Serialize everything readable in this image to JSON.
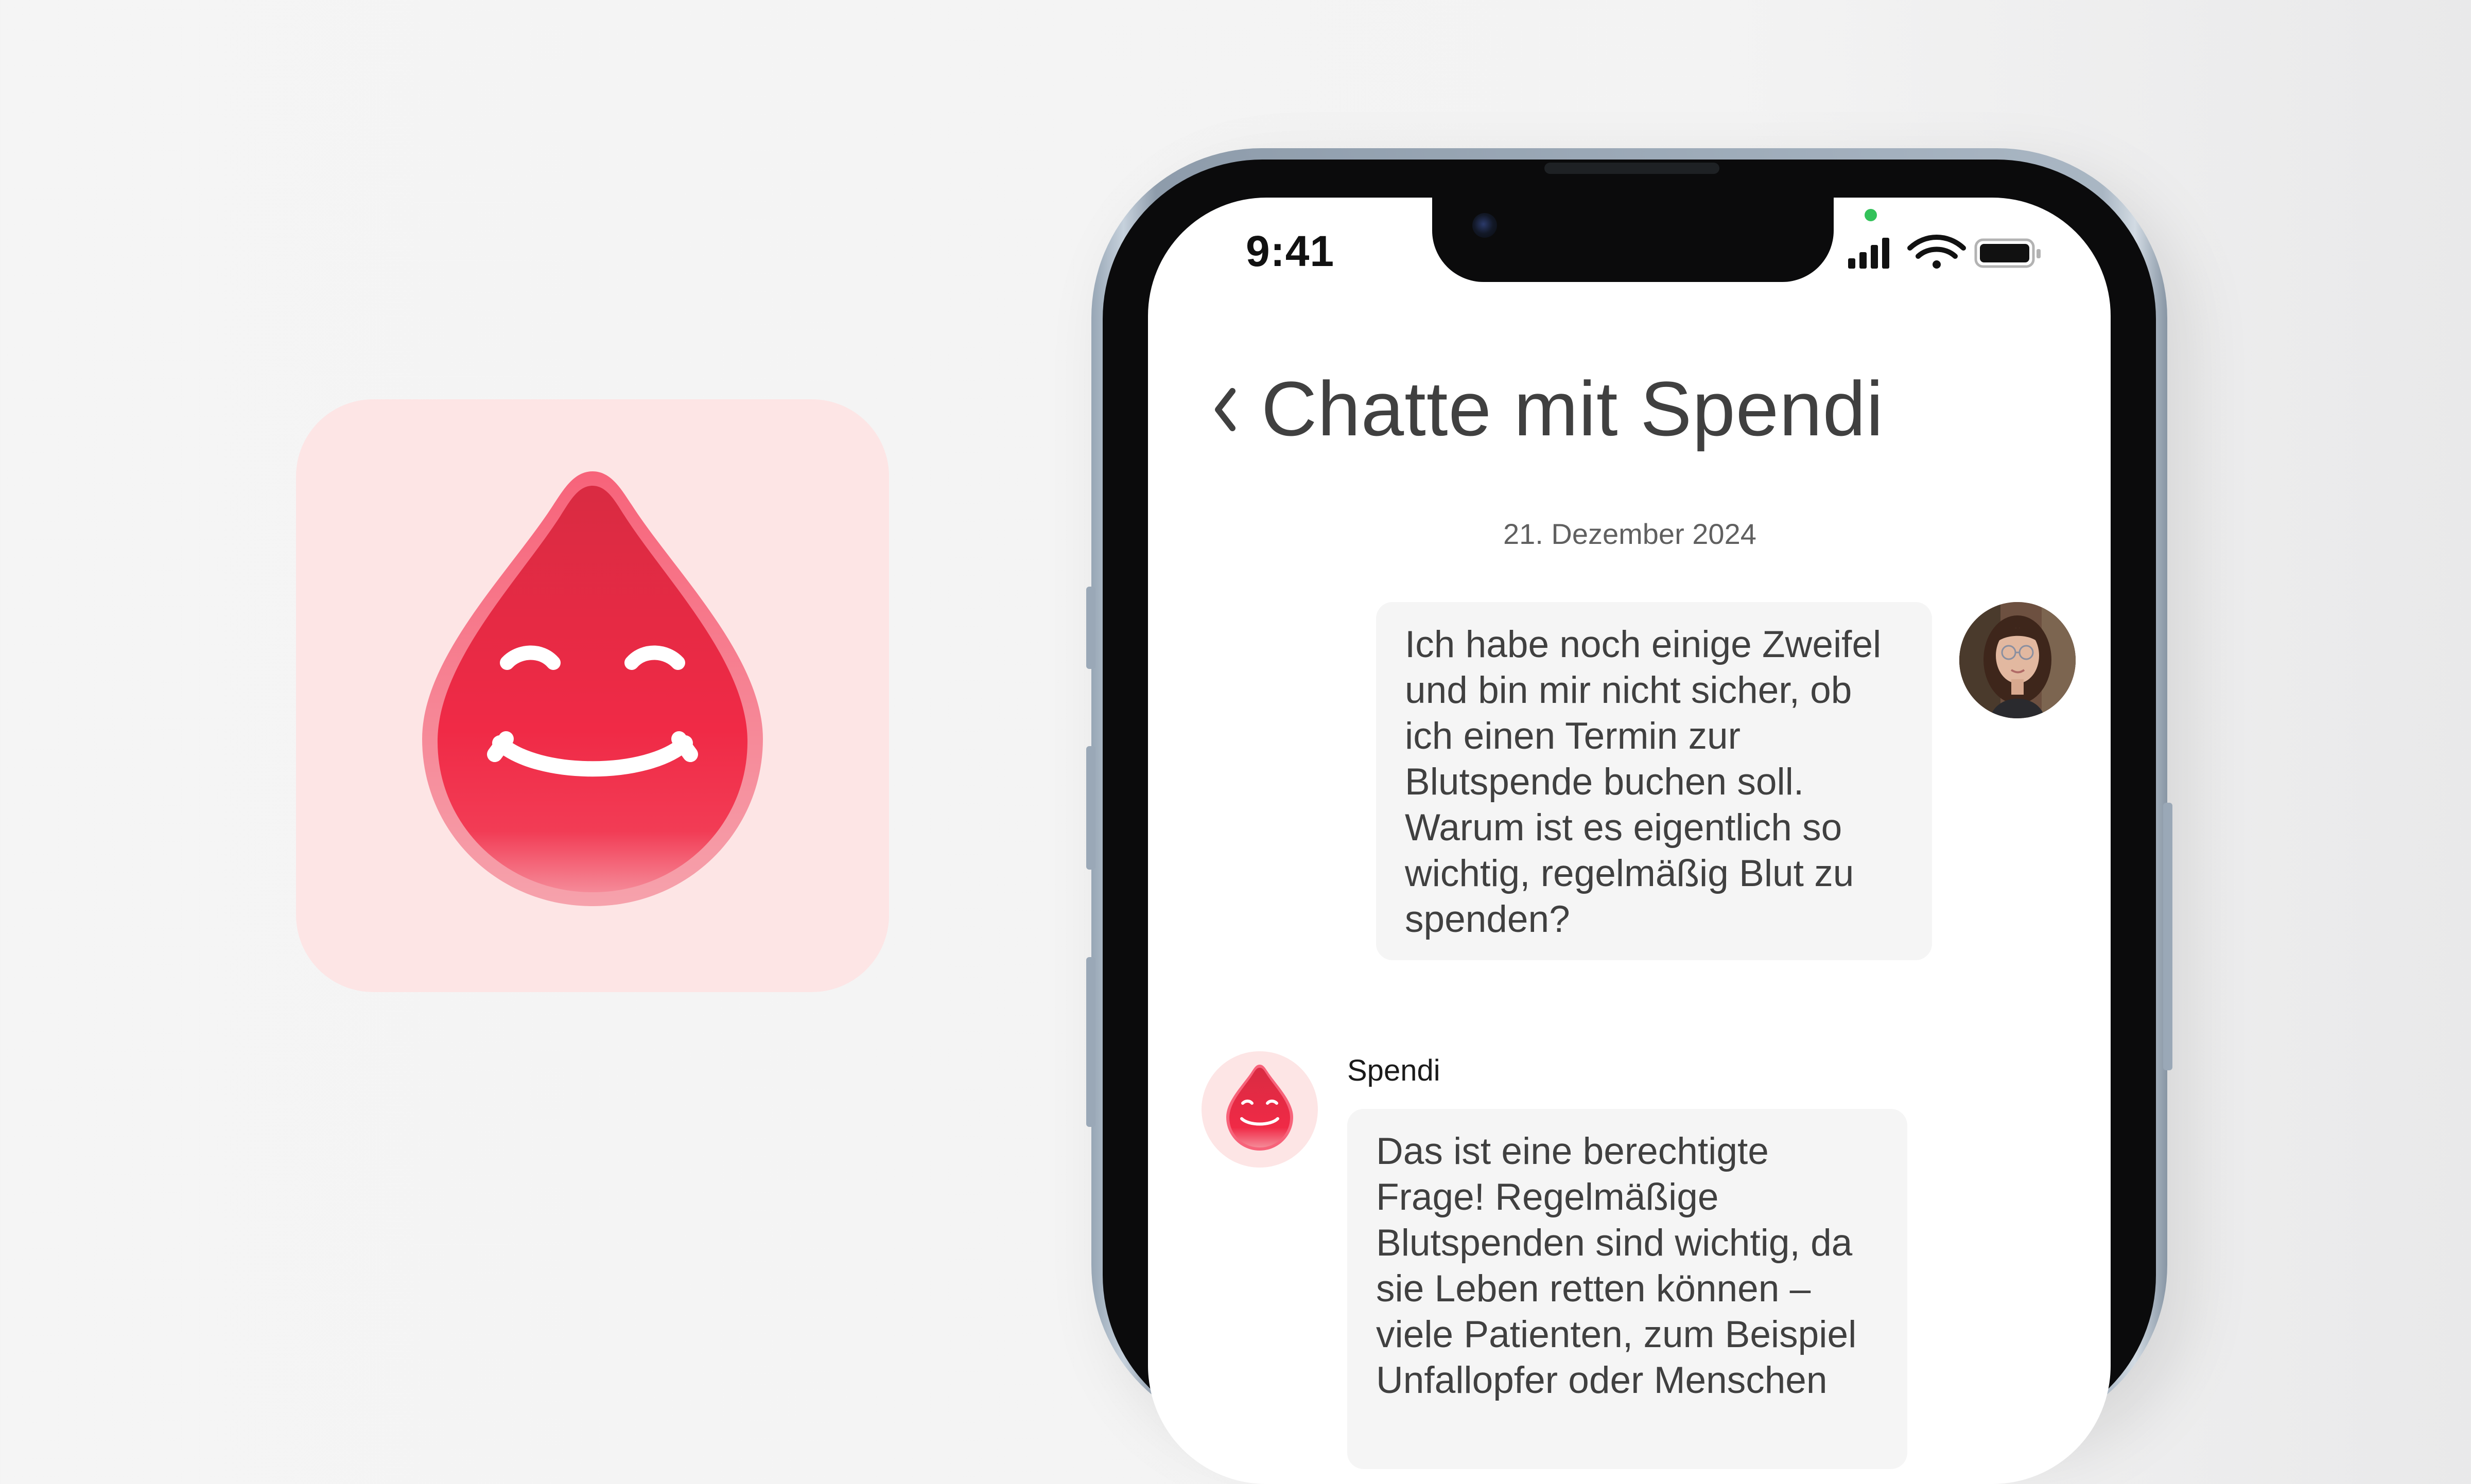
{
  "status_bar": {
    "time": "9:41"
  },
  "header": {
    "title": "Chatte mit Spendi"
  },
  "chat": {
    "date": "21. Dezember 2024",
    "messages": [
      {
        "sender": "user",
        "lines": [
          "Ich habe noch einige Zweifel",
          "und bin mir nicht sicher, ob",
          "ich einen Termin zur",
          "Blutspende buchen soll.",
          "Warum ist es eigentlich so",
          "wichtig, regelmäßig Blut zu",
          "spenden?"
        ]
      },
      {
        "sender": "Spendi",
        "lines": [
          "Das ist eine berechtigte",
          "Frage! Regelmäßige",
          "Blutspenden sind wichtig, da",
          "sie Leben retten können –",
          "viele Patienten, zum Beispiel",
          "Unfallopfer oder Menschen"
        ]
      }
    ]
  },
  "colors": {
    "brand_red": "#f02a46",
    "brand_pink_bg": "#fde5e5",
    "bubble_bg": "#f5f5f5",
    "text": "#404040"
  },
  "icons": [
    "blood-drop-mascot-icon",
    "back-chevron-icon",
    "signal-icon",
    "wifi-icon",
    "battery-icon"
  ]
}
